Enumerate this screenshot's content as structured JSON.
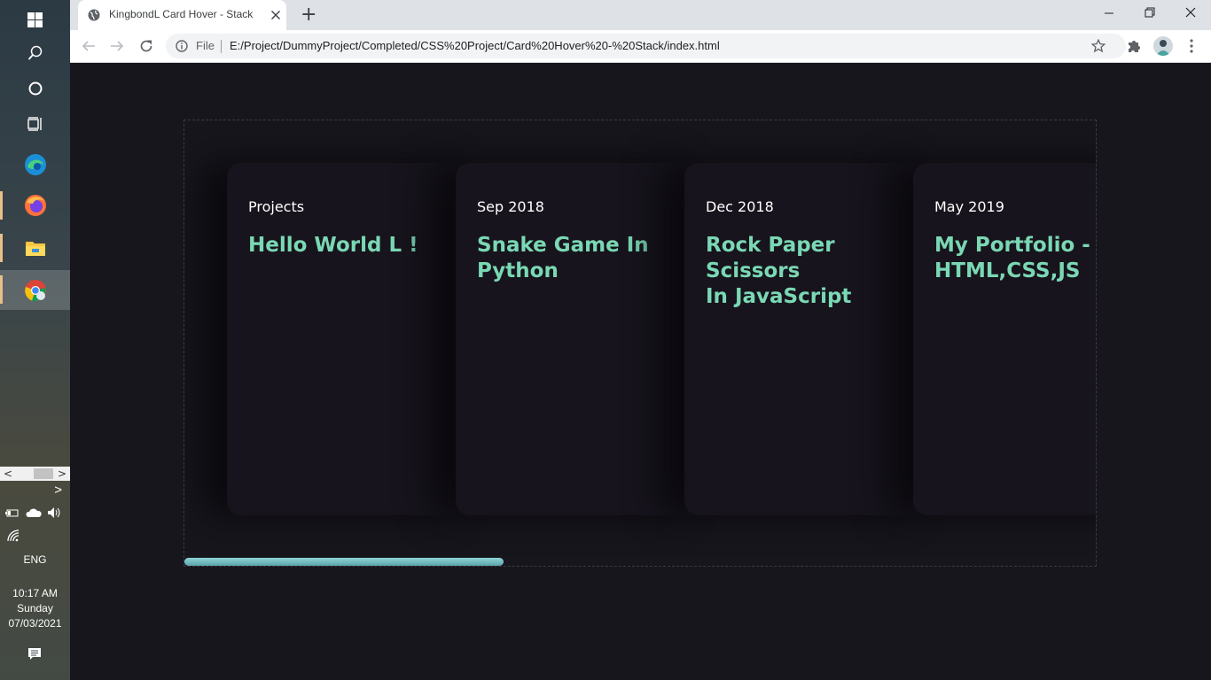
{
  "taskbar": {
    "scroll_left": "<",
    "scroll_right": ">",
    "tray_expand": ">",
    "language": "ENG",
    "time": "10:17 AM",
    "day": "Sunday",
    "date": "07/03/2021"
  },
  "browser": {
    "tab_title": "KingbondL Card Hover - Stack",
    "new_tab": "+",
    "security_chip": "File",
    "url": "E:/Project/DummyProject/Completed/CSS%20Project/Card%20Hover%20-%20Stack/index.html"
  },
  "cards": [
    {
      "date": "Projects",
      "title": "Hello World L !"
    },
    {
      "date": "Sep 2018",
      "title": "Snake Game In\nPython"
    },
    {
      "date": "Dec 2018",
      "title": "Rock Paper Scissors\nIn JavaScript"
    },
    {
      "date": "May 2019",
      "title": "My Portfolio -\nHTML,CSS,JS"
    }
  ],
  "scroll_progress": 0.35,
  "colors": {
    "accent": "#7ad8b4",
    "background": "#17161d",
    "card": "#17141d",
    "scrollbar": "#6dbcc0"
  }
}
